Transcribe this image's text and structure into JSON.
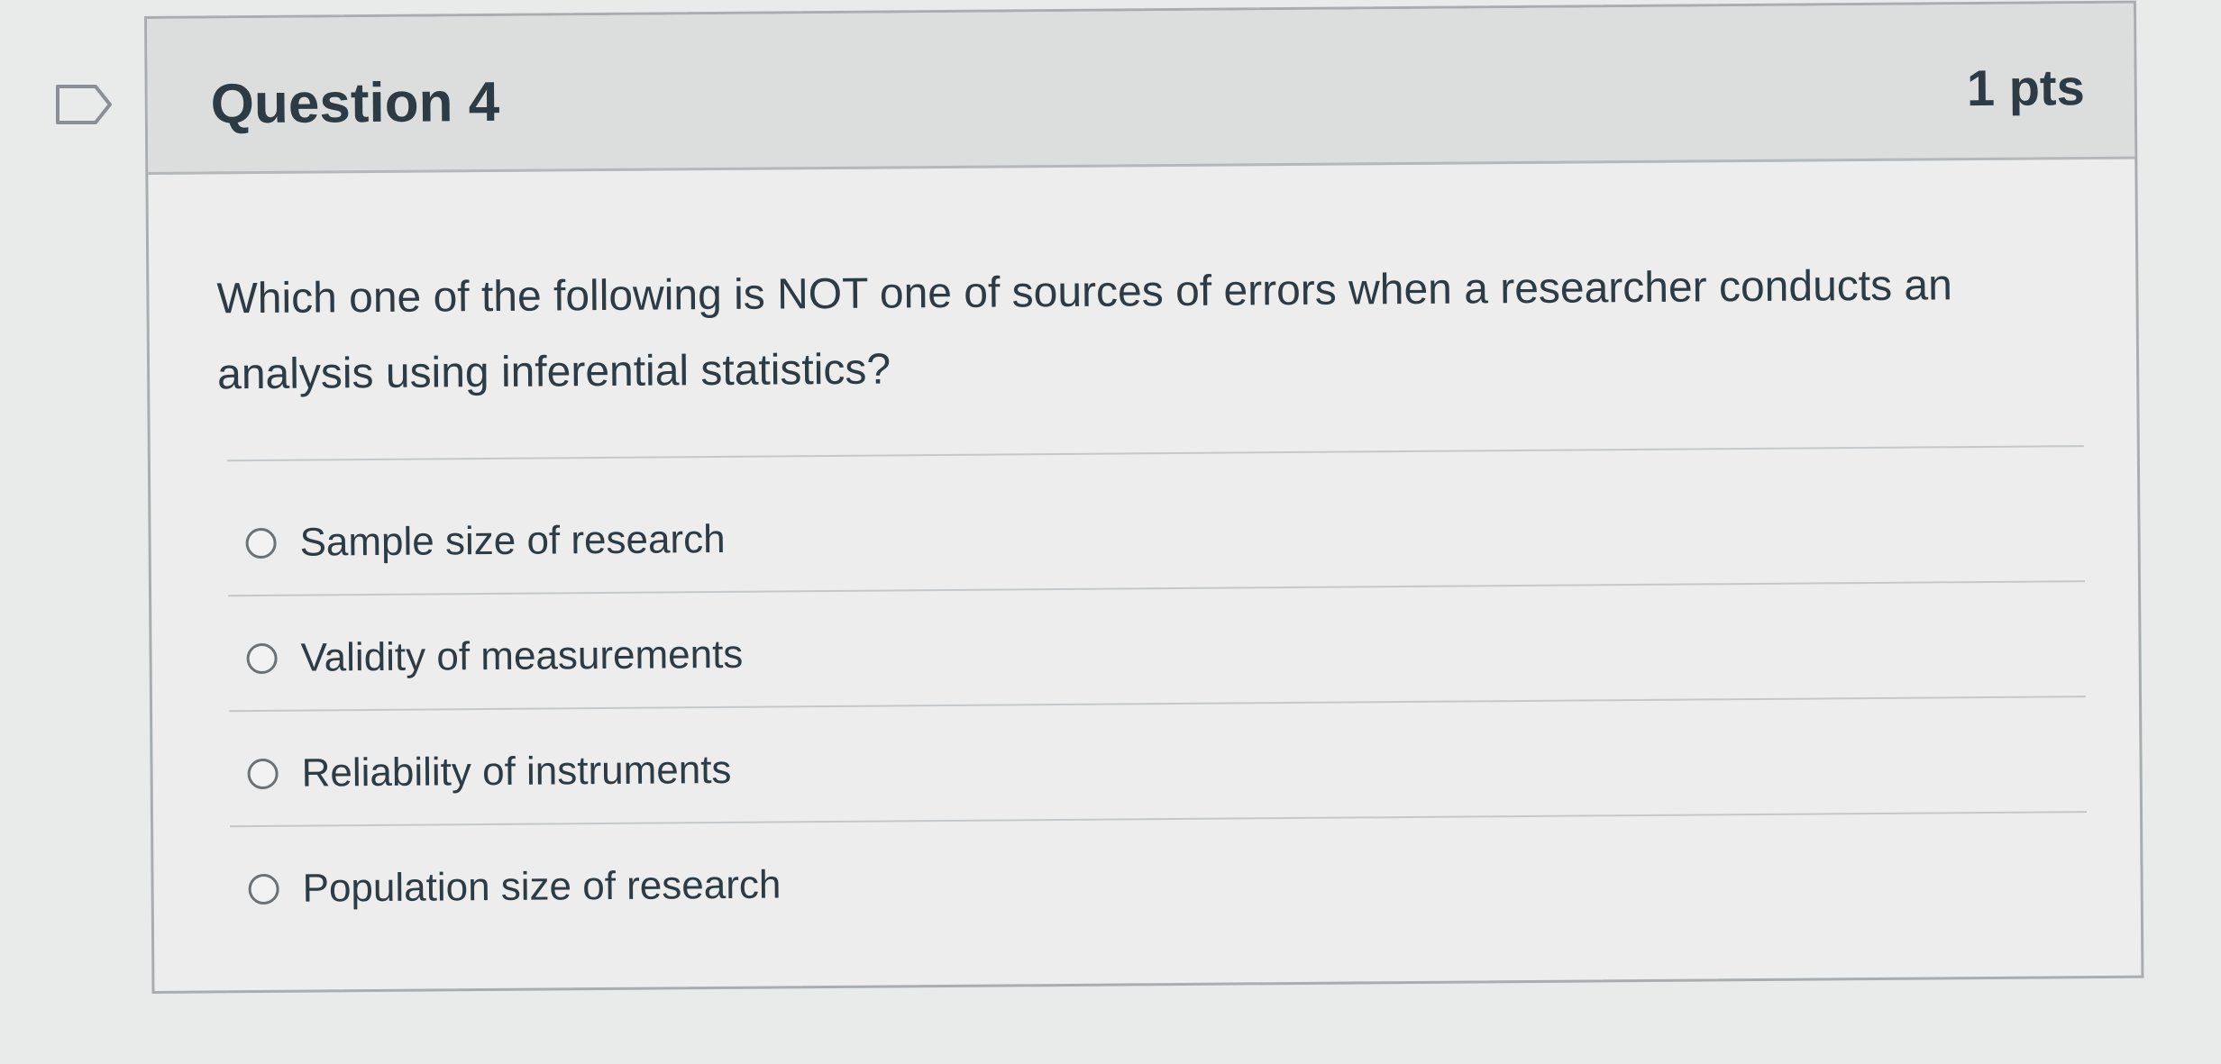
{
  "question": {
    "title": "Question 4",
    "points": "1 pts",
    "text": "Which one of the following is NOT one of sources of errors when a researcher conducts an analysis using inferential statistics?",
    "answers": [
      {
        "label": "Sample size of research",
        "selected": false
      },
      {
        "label": "Validity of measurements",
        "selected": false
      },
      {
        "label": "Reliability of instruments",
        "selected": false
      },
      {
        "label": "Population size of research",
        "selected": false
      }
    ]
  },
  "icons": {
    "bookmark": "bookmark-flag-icon",
    "radio": "radio-unchecked-icon"
  },
  "colors": {
    "text": "#2d3b45",
    "header_bg": "#dcdddd",
    "border": "#a9adaf"
  }
}
